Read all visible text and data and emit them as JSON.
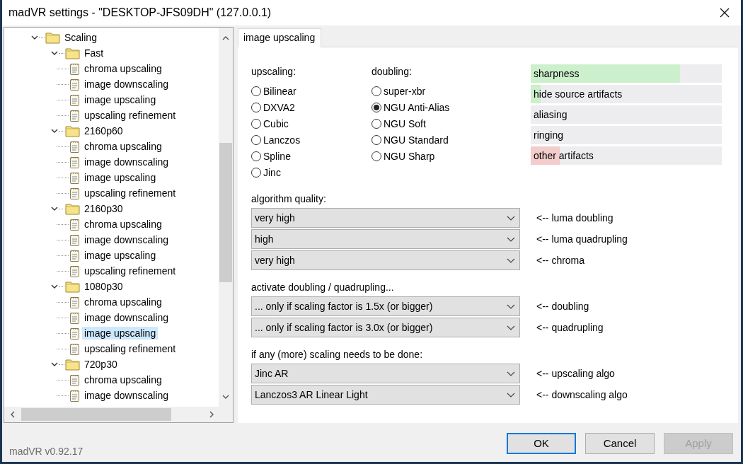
{
  "window": {
    "title": "madVR settings - \"DESKTOP-JFS09DH\" (127.0.0.1)"
  },
  "tree": {
    "items": [
      {
        "label": "Scaling",
        "kind": "folder",
        "expanded": true,
        "selected": false,
        "children": [
          {
            "label": "Fast",
            "kind": "folder",
            "expanded": true,
            "selected": false,
            "children": [
              {
                "label": "chroma upscaling",
                "kind": "page",
                "selected": false
              },
              {
                "label": "image downscaling",
                "kind": "page",
                "selected": false
              },
              {
                "label": "image upscaling",
                "kind": "page",
                "selected": false
              },
              {
                "label": "upscaling refinement",
                "kind": "page",
                "selected": false
              }
            ]
          },
          {
            "label": "2160p60",
            "kind": "folder",
            "expanded": true,
            "selected": false,
            "children": [
              {
                "label": "chroma upscaling",
                "kind": "page",
                "selected": false
              },
              {
                "label": "image downscaling",
                "kind": "page",
                "selected": false
              },
              {
                "label": "image upscaling",
                "kind": "page",
                "selected": false
              },
              {
                "label": "upscaling refinement",
                "kind": "page",
                "selected": false
              }
            ]
          },
          {
            "label": "2160p30",
            "kind": "folder",
            "expanded": true,
            "selected": false,
            "children": [
              {
                "label": "chroma upscaling",
                "kind": "page",
                "selected": false
              },
              {
                "label": "image downscaling",
                "kind": "page",
                "selected": false
              },
              {
                "label": "image upscaling",
                "kind": "page",
                "selected": false
              },
              {
                "label": "upscaling refinement",
                "kind": "page",
                "selected": false
              }
            ]
          },
          {
            "label": "1080p30",
            "kind": "folder",
            "expanded": true,
            "selected": false,
            "children": [
              {
                "label": "chroma upscaling",
                "kind": "page",
                "selected": false
              },
              {
                "label": "image downscaling",
                "kind": "page",
                "selected": false
              },
              {
                "label": "image upscaling",
                "kind": "page",
                "selected": true
              },
              {
                "label": "upscaling refinement",
                "kind": "page",
                "selected": false
              }
            ]
          },
          {
            "label": "720p30",
            "kind": "folder",
            "expanded": true,
            "selected": false,
            "children": [
              {
                "label": "chroma upscaling",
                "kind": "page",
                "selected": false
              },
              {
                "label": "image downscaling",
                "kind": "page",
                "selected": false
              }
            ]
          }
        ]
      }
    ]
  },
  "tabs": [
    {
      "label": "image upscaling",
      "selected": true
    }
  ],
  "radio_groups": [
    {
      "title": "upscaling:",
      "options": [
        {
          "label": "Bilinear",
          "selected": false
        },
        {
          "label": "DXVA2",
          "selected": false
        },
        {
          "label": "Cubic",
          "selected": false
        },
        {
          "label": "Lanczos",
          "selected": false
        },
        {
          "label": "Spline",
          "selected": false
        },
        {
          "label": "Jinc",
          "selected": false
        }
      ]
    },
    {
      "title": "doubling:",
      "options": [
        {
          "label": "super-xbr",
          "selected": false
        },
        {
          "label": "NGU Anti-Alias",
          "selected": true
        },
        {
          "label": "NGU Soft",
          "selected": false
        },
        {
          "label": "NGU Standard",
          "selected": false
        },
        {
          "label": "NGU Sharp",
          "selected": false
        }
      ]
    }
  ],
  "meters": [
    {
      "label": "sharpness",
      "level": 0.78,
      "color": "#ccefcc"
    },
    {
      "label": "hide source artifacts",
      "level": 0.05,
      "color": "#ccefcc"
    },
    {
      "label": "aliasing"
    },
    {
      "label": "ringing"
    },
    {
      "label": "other artifacts",
      "level": 0.15,
      "color": "#f3cccc"
    }
  ],
  "sections": [
    {
      "title": "algorithm quality:",
      "rows": [
        {
          "value": "very high",
          "note": "<-- luma doubling"
        },
        {
          "value": "high",
          "note": "<-- luma quadrupling"
        },
        {
          "value": "very high",
          "note": "<-- chroma"
        }
      ]
    },
    {
      "title": "activate doubling / quadrupling...",
      "rows": [
        {
          "value": "... only if scaling factor is 1.5x (or bigger)",
          "note": "<-- doubling"
        },
        {
          "value": "... only if scaling factor is 3.0x (or bigger)",
          "note": "<-- quadrupling"
        }
      ]
    },
    {
      "title": "if any (more) scaling needs to be done:",
      "rows": [
        {
          "value": "Jinc AR",
          "note": "<-- upscaling algo"
        },
        {
          "value": "Lanczos3 AR Linear Light",
          "note": "<-- downscaling algo"
        }
      ]
    }
  ],
  "footer": {
    "version": "madVR v0.92.17",
    "buttons": [
      {
        "label": "OK",
        "default": true,
        "disabled": false
      },
      {
        "label": "Cancel",
        "default": false,
        "disabled": false
      },
      {
        "label": "Apply",
        "default": false,
        "disabled": true
      }
    ]
  }
}
